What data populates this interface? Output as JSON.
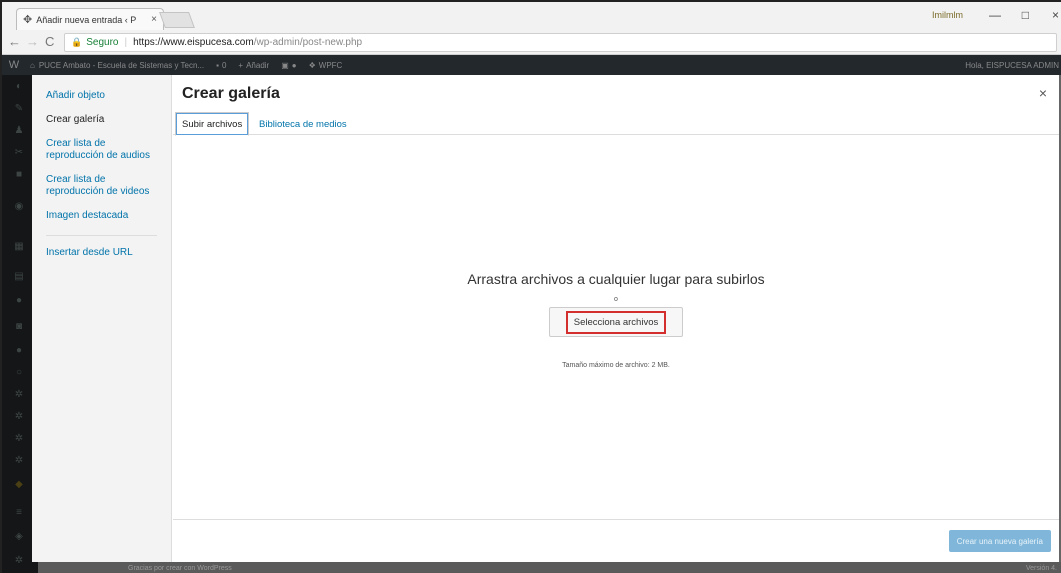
{
  "browser": {
    "tab_title": "Añadir nueva entrada ‹ P",
    "tab_close": "×",
    "user_label": "Imilmlm",
    "win_min": "—",
    "win_max": "□",
    "win_close": "×",
    "nav_back": "←",
    "nav_forward": "→",
    "nav_reload": "C",
    "secure_label": "Seguro",
    "url_base": "https://www.eispucesa.com",
    "url_path": "/wp-admin/post-new.php"
  },
  "adminbar": {
    "wp_logo": "W",
    "site_name": "PUCE Ambato - Escuela de Sistemas y Tecn...",
    "comments": "0",
    "add_new": "Añadir",
    "plugin": "WPFC",
    "howdy": "Hola, EISPUCESA ADMIN"
  },
  "modal": {
    "title": "Crear galería",
    "close": "×",
    "menu": [
      {
        "label": "Añadir objeto",
        "active": false
      },
      {
        "label": "Crear galería",
        "active": true
      },
      {
        "label": "Crear lista de reproducción de audios",
        "active": false
      },
      {
        "label": "Crear lista de reproducción de videos",
        "active": false
      },
      {
        "label": "Imagen destacada",
        "active": false
      }
    ],
    "menu_extra": "Insertar desde URL",
    "tabs": [
      {
        "label": "Subir archivos",
        "active": true
      },
      {
        "label": "Biblioteca de medios",
        "active": false
      }
    ],
    "drop_text": "Arrastra archivos a cualquier lugar para subirlos",
    "or_text": "o",
    "select_button": "Selecciona archivos",
    "max_size": "Tamaño máximo de archivo: 2 MB.",
    "create_button": "Crear una nueva galería"
  },
  "footer": {
    "thanks": "Gracias por crear con WordPress",
    "version": "Versión 4."
  },
  "colors": {
    "admin_bar": "#23282d",
    "link": "#0073aa",
    "highlight_box": "#d32f2f",
    "primary_disabled": "#7fb6d9"
  }
}
